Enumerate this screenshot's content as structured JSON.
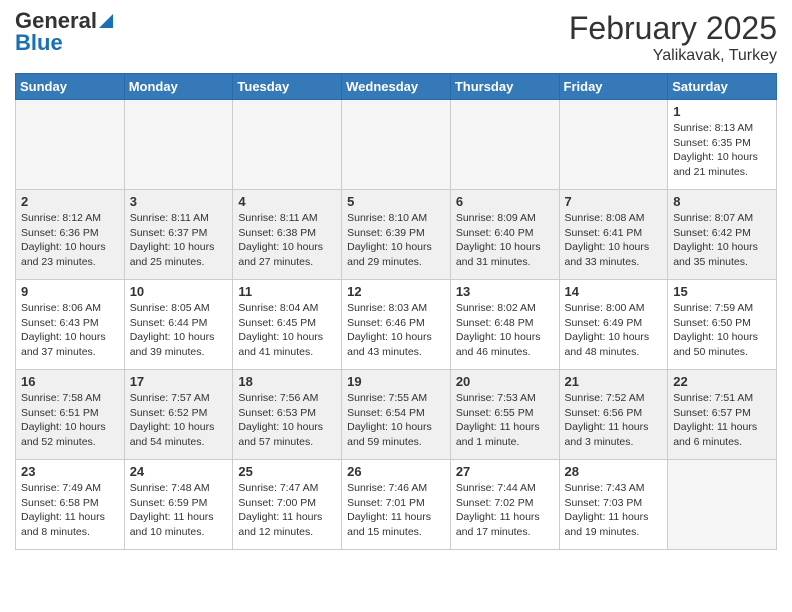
{
  "logo": {
    "general": "General",
    "blue": "Blue"
  },
  "header": {
    "month_year": "February 2025",
    "location": "Yalikavak, Turkey"
  },
  "weekdays": [
    "Sunday",
    "Monday",
    "Tuesday",
    "Wednesday",
    "Thursday",
    "Friday",
    "Saturday"
  ],
  "weeks": [
    [
      {
        "day": "",
        "info": ""
      },
      {
        "day": "",
        "info": ""
      },
      {
        "day": "",
        "info": ""
      },
      {
        "day": "",
        "info": ""
      },
      {
        "day": "",
        "info": ""
      },
      {
        "day": "",
        "info": ""
      },
      {
        "day": "1",
        "info": "Sunrise: 8:13 AM\nSunset: 6:35 PM\nDaylight: 10 hours and 21 minutes."
      }
    ],
    [
      {
        "day": "2",
        "info": "Sunrise: 8:12 AM\nSunset: 6:36 PM\nDaylight: 10 hours and 23 minutes."
      },
      {
        "day": "3",
        "info": "Sunrise: 8:11 AM\nSunset: 6:37 PM\nDaylight: 10 hours and 25 minutes."
      },
      {
        "day": "4",
        "info": "Sunrise: 8:11 AM\nSunset: 6:38 PM\nDaylight: 10 hours and 27 minutes."
      },
      {
        "day": "5",
        "info": "Sunrise: 8:10 AM\nSunset: 6:39 PM\nDaylight: 10 hours and 29 minutes."
      },
      {
        "day": "6",
        "info": "Sunrise: 8:09 AM\nSunset: 6:40 PM\nDaylight: 10 hours and 31 minutes."
      },
      {
        "day": "7",
        "info": "Sunrise: 8:08 AM\nSunset: 6:41 PM\nDaylight: 10 hours and 33 minutes."
      },
      {
        "day": "8",
        "info": "Sunrise: 8:07 AM\nSunset: 6:42 PM\nDaylight: 10 hours and 35 minutes."
      }
    ],
    [
      {
        "day": "9",
        "info": "Sunrise: 8:06 AM\nSunset: 6:43 PM\nDaylight: 10 hours and 37 minutes."
      },
      {
        "day": "10",
        "info": "Sunrise: 8:05 AM\nSunset: 6:44 PM\nDaylight: 10 hours and 39 minutes."
      },
      {
        "day": "11",
        "info": "Sunrise: 8:04 AM\nSunset: 6:45 PM\nDaylight: 10 hours and 41 minutes."
      },
      {
        "day": "12",
        "info": "Sunrise: 8:03 AM\nSunset: 6:46 PM\nDaylight: 10 hours and 43 minutes."
      },
      {
        "day": "13",
        "info": "Sunrise: 8:02 AM\nSunset: 6:48 PM\nDaylight: 10 hours and 46 minutes."
      },
      {
        "day": "14",
        "info": "Sunrise: 8:00 AM\nSunset: 6:49 PM\nDaylight: 10 hours and 48 minutes."
      },
      {
        "day": "15",
        "info": "Sunrise: 7:59 AM\nSunset: 6:50 PM\nDaylight: 10 hours and 50 minutes."
      }
    ],
    [
      {
        "day": "16",
        "info": "Sunrise: 7:58 AM\nSunset: 6:51 PM\nDaylight: 10 hours and 52 minutes."
      },
      {
        "day": "17",
        "info": "Sunrise: 7:57 AM\nSunset: 6:52 PM\nDaylight: 10 hours and 54 minutes."
      },
      {
        "day": "18",
        "info": "Sunrise: 7:56 AM\nSunset: 6:53 PM\nDaylight: 10 hours and 57 minutes."
      },
      {
        "day": "19",
        "info": "Sunrise: 7:55 AM\nSunset: 6:54 PM\nDaylight: 10 hours and 59 minutes."
      },
      {
        "day": "20",
        "info": "Sunrise: 7:53 AM\nSunset: 6:55 PM\nDaylight: 11 hours and 1 minute."
      },
      {
        "day": "21",
        "info": "Sunrise: 7:52 AM\nSunset: 6:56 PM\nDaylight: 11 hours and 3 minutes."
      },
      {
        "day": "22",
        "info": "Sunrise: 7:51 AM\nSunset: 6:57 PM\nDaylight: 11 hours and 6 minutes."
      }
    ],
    [
      {
        "day": "23",
        "info": "Sunrise: 7:49 AM\nSunset: 6:58 PM\nDaylight: 11 hours and 8 minutes."
      },
      {
        "day": "24",
        "info": "Sunrise: 7:48 AM\nSunset: 6:59 PM\nDaylight: 11 hours and 10 minutes."
      },
      {
        "day": "25",
        "info": "Sunrise: 7:47 AM\nSunset: 7:00 PM\nDaylight: 11 hours and 12 minutes."
      },
      {
        "day": "26",
        "info": "Sunrise: 7:46 AM\nSunset: 7:01 PM\nDaylight: 11 hours and 15 minutes."
      },
      {
        "day": "27",
        "info": "Sunrise: 7:44 AM\nSunset: 7:02 PM\nDaylight: 11 hours and 17 minutes."
      },
      {
        "day": "28",
        "info": "Sunrise: 7:43 AM\nSunset: 7:03 PM\nDaylight: 11 hours and 19 minutes."
      },
      {
        "day": "",
        "info": ""
      }
    ]
  ]
}
